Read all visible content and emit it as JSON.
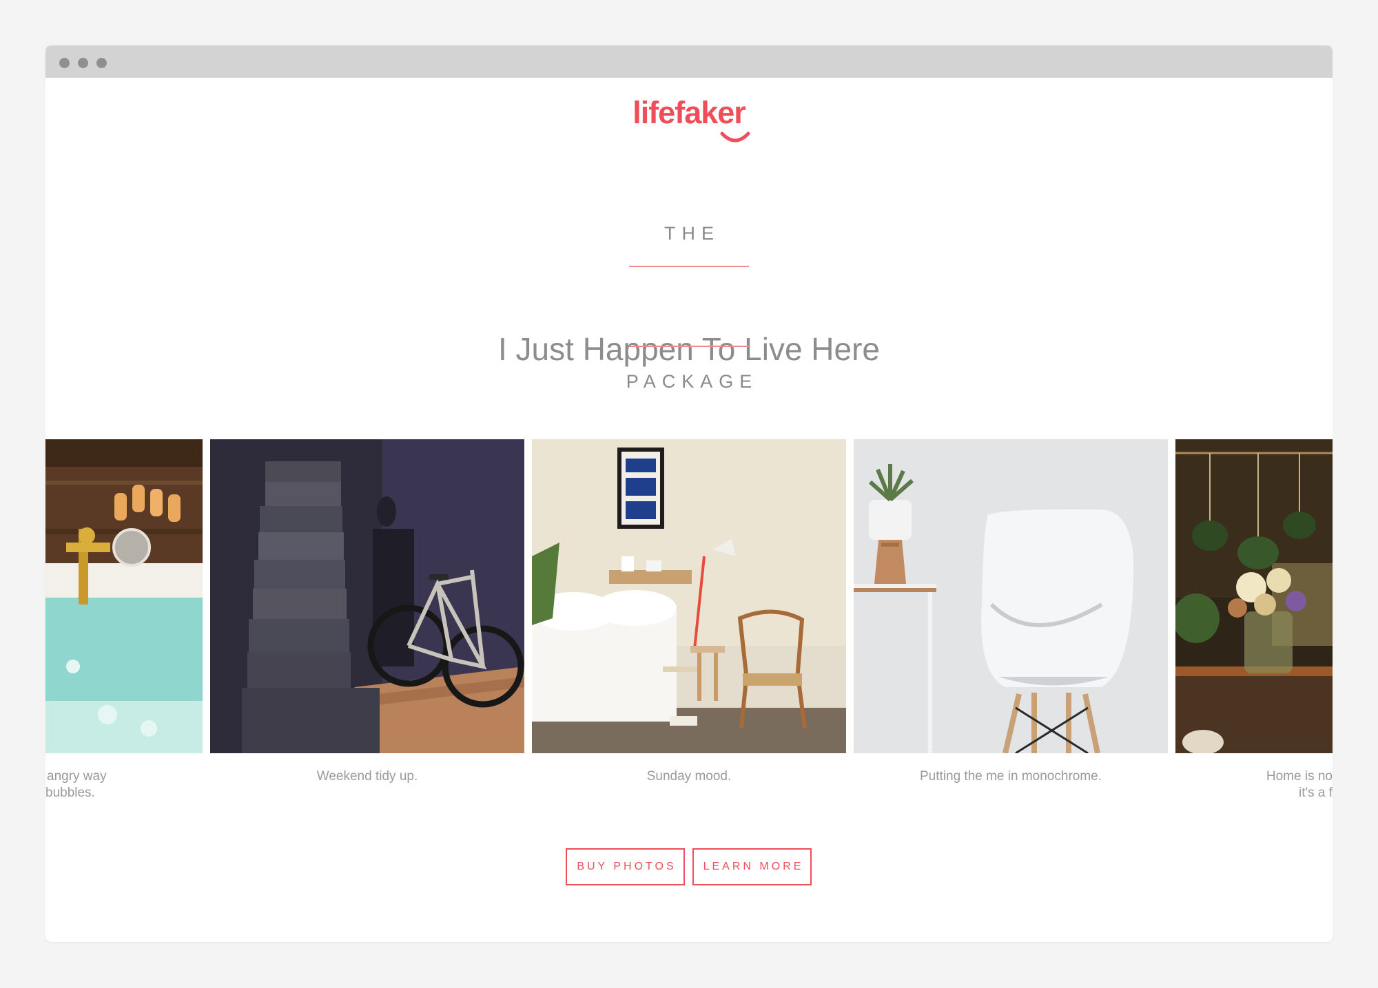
{
  "brand": {
    "logo_text": "lifefaker",
    "accent_color": "#ef4d59"
  },
  "hero": {
    "kicker_top": "THE",
    "headline": "I Just Happen To Live Here",
    "kicker_bottom": "PACKAGE"
  },
  "gallery": {
    "photos": [
      {
        "icon": "bathtub-photo",
        "caption_line1": "angry way",
        "caption_line2": "bubbles."
      },
      {
        "icon": "staircase-bicycle-photo",
        "caption_line1": "Weekend tidy up.",
        "caption_line2": ""
      },
      {
        "icon": "bedroom-photo",
        "caption_line1": "Sunday mood.",
        "caption_line2": ""
      },
      {
        "icon": "white-chair-photo",
        "caption_line1": "Putting the me in monochrome.",
        "caption_line2": ""
      },
      {
        "icon": "plants-flowers-photo",
        "caption_line1": "Home is no",
        "caption_line2": "it's a f"
      }
    ]
  },
  "actions": {
    "buy_label": "BUY PHOTOS",
    "learn_label": "LEARN MORE"
  }
}
